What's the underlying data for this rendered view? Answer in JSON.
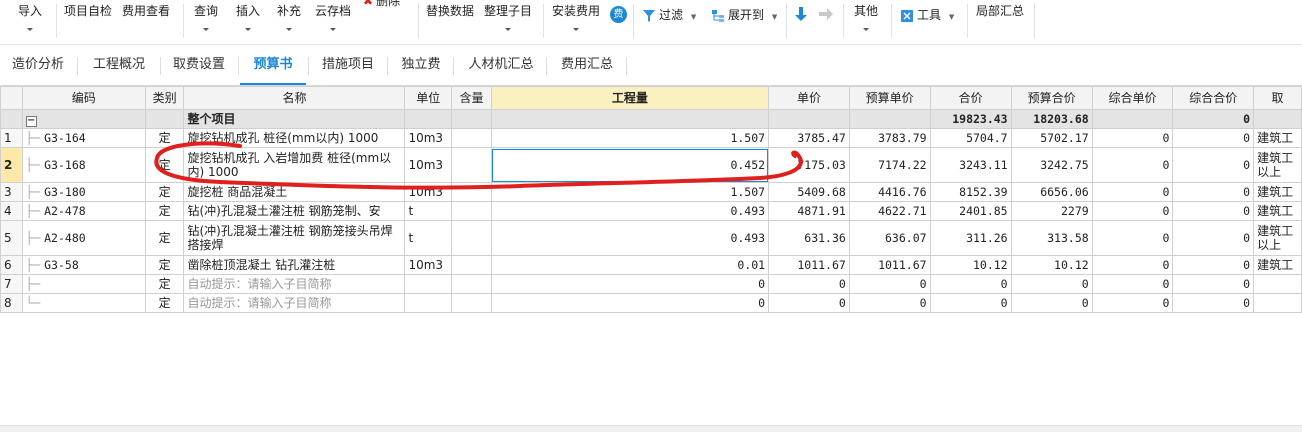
{
  "toolbar": {
    "import": "导入",
    "self_check": "项目自检",
    "fee_check": "费用查看",
    "query": "查询",
    "insert": "插入",
    "supplement": "补充",
    "cloud_save": "云存档",
    "delete": "删除",
    "replace": "替换数据",
    "organize": "整理子目",
    "install_fee": "安装费用",
    "fee_badge": "费",
    "filter": "过滤",
    "expand": "展开到",
    "other": "其他",
    "tools": "工具",
    "partial_sum": "局部汇总"
  },
  "tabs": [
    "造价分析",
    "工程概况",
    "取费设置",
    "预算书",
    "措施项目",
    "独立费",
    "人材机汇总",
    "费用汇总"
  ],
  "active_tab": "预算书",
  "columns": [
    "",
    "编码",
    "类别",
    "名称",
    "单位",
    "含量",
    "工程量",
    "单价",
    "预算单价",
    "合价",
    "预算合价",
    "综合单价",
    "综合合价",
    "取"
  ],
  "total_row": {
    "box": "−",
    "name": "整个项目",
    "hejia": "19823.43",
    "ys_hejia": "18203.68",
    "zh_hejia": "0"
  },
  "rows": [
    {
      "no": "1",
      "code": "G3-164",
      "type": "定",
      "name": "旋挖钻机成孔 桩径(mm以内) 1000",
      "unit": "10m3",
      "content": "",
      "qty": "1.507",
      "price": "3785.47",
      "ys_price": "3783.79",
      "hejia": "5704.7",
      "ys_hejia": "5702.17",
      "zh_price": "0",
      "zh_hejia": "0",
      "extra": "建筑工"
    },
    {
      "no": "2",
      "code": "G3-168",
      "type": "定",
      "name": "旋挖钻机成孔 入岩增加费 桩径(mm以内) 1000",
      "unit": "10m3",
      "content": "",
      "qty": "0.452",
      "price": "7175.03",
      "ys_price": "7174.22",
      "hejia": "3243.11",
      "ys_hejia": "3242.75",
      "zh_price": "0",
      "zh_hejia": "0",
      "extra": "建筑工 以上"
    },
    {
      "no": "3",
      "code": "G3-180",
      "type": "定",
      "name": "旋挖桩 商品混凝土",
      "unit": "10m3",
      "content": "",
      "qty": "1.507",
      "price": "5409.68",
      "ys_price": "4416.76",
      "hejia": "8152.39",
      "ys_hejia": "6656.06",
      "zh_price": "0",
      "zh_hejia": "0",
      "extra": "建筑工"
    },
    {
      "no": "4",
      "code": "A2-478",
      "type": "定",
      "name": "钻(冲)孔混凝土灌注桩 钢筋笼制、安",
      "unit": "t",
      "content": "",
      "qty": "0.493",
      "price": "4871.91",
      "ys_price": "4622.71",
      "hejia": "2401.85",
      "ys_hejia": "2279",
      "zh_price": "0",
      "zh_hejia": "0",
      "extra": "建筑工"
    },
    {
      "no": "5",
      "code": "A2-480",
      "type": "定",
      "name": "钻(冲)孔混凝土灌注桩 钢筋笼接头吊焊搭接焊",
      "unit": "t",
      "content": "",
      "qty": "0.493",
      "price": "631.36",
      "ys_price": "636.07",
      "hejia": "311.26",
      "ys_hejia": "313.58",
      "zh_price": "0",
      "zh_hejia": "0",
      "extra": "建筑工 以上"
    },
    {
      "no": "6",
      "code": "G3-58",
      "type": "定",
      "name": "凿除桩顶混凝土 钻孔灌注桩",
      "unit": "10m3",
      "content": "",
      "qty": "0.01",
      "price": "1011.67",
      "ys_price": "1011.67",
      "hejia": "10.12",
      "ys_hejia": "10.12",
      "zh_price": "0",
      "zh_hejia": "0",
      "extra": "建筑工"
    },
    {
      "no": "7",
      "code": "",
      "type": "定",
      "name": "自动提示：请输入子目简称",
      "unit": "",
      "content": "",
      "qty": "0",
      "price": "0",
      "ys_price": "0",
      "hejia": "0",
      "ys_hejia": "0",
      "zh_price": "0",
      "zh_hejia": "0",
      "extra": ""
    },
    {
      "no": "8",
      "code": "",
      "type": "定",
      "name": "自动提示：请输入子目简称",
      "unit": "",
      "content": "",
      "qty": "0",
      "price": "0",
      "ys_price": "0",
      "hejia": "0",
      "ys_hejia": "0",
      "zh_price": "0",
      "zh_hejia": "0",
      "extra": ""
    }
  ],
  "colors": {
    "accent": "#1e88d8",
    "selected_header": "#fbf0c0",
    "annotation_red": "#e0201c"
  }
}
